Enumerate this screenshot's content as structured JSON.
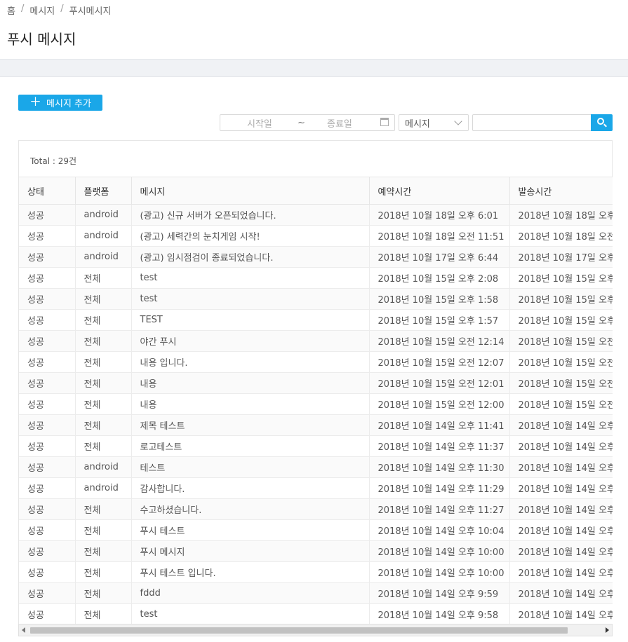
{
  "breadcrumb": {
    "home": "홈",
    "section": "메시지",
    "current": "푸시메시지",
    "separator": "/"
  },
  "page": {
    "title": "푸시 메시지"
  },
  "toolbar": {
    "add_label": "메시지 추가",
    "add_icon": "plus-icon",
    "date_start_placeholder": "시작일",
    "date_tilde": "~",
    "date_end_placeholder": "종료일",
    "select_value": "메시지",
    "search_value": "",
    "accent_color": "#1aa7e8"
  },
  "summary": {
    "total": "Total : 29건"
  },
  "table": {
    "columns": [
      "상태",
      "플랫폼",
      "메시지",
      "예약시간",
      "발송시간"
    ],
    "rows": [
      [
        "성공",
        "android",
        "(광고) 신규 서버가 오픈되었습니다.",
        "2018년 10월 18일 오후 6:01",
        "2018년 10월 18일 오후"
      ],
      [
        "성공",
        "android",
        "(광고) 세력간의 눈치게임 시작!",
        "2018년 10월 18일 오전 11:51",
        "2018년 10월 18일 오전"
      ],
      [
        "성공",
        "android",
        "(광고) 임시점검이 종료되었습니다.",
        "2018년 10월 17일 오후 6:44",
        "2018년 10월 17일 오후"
      ],
      [
        "성공",
        "전체",
        "test",
        "2018년 10월 15일 오후 2:08",
        "2018년 10월 15일 오후"
      ],
      [
        "성공",
        "전체",
        "test",
        "2018년 10월 15일 오후 1:58",
        "2018년 10월 15일 오후"
      ],
      [
        "성공",
        "전체",
        "TEST",
        "2018년 10월 15일 오후 1:57",
        "2018년 10월 15일 오후"
      ],
      [
        "성공",
        "전체",
        "야간 푸시",
        "2018년 10월 15일 오전 12:14",
        "2018년 10월 15일 오전"
      ],
      [
        "성공",
        "전체",
        "내용 입니다.",
        "2018년 10월 15일 오전 12:07",
        "2018년 10월 15일 오전"
      ],
      [
        "성공",
        "전체",
        "내용",
        "2018년 10월 15일 오전 12:01",
        "2018년 10월 15일 오전"
      ],
      [
        "성공",
        "전체",
        "내용",
        "2018년 10월 15일 오전 12:00",
        "2018년 10월 15일 오전"
      ],
      [
        "성공",
        "전체",
        "제목 테스트",
        "2018년 10월 14일 오후 11:41",
        "2018년 10월 14일 오후"
      ],
      [
        "성공",
        "전체",
        "로고테스트",
        "2018년 10월 14일 오후 11:37",
        "2018년 10월 14일 오후"
      ],
      [
        "성공",
        "android",
        "테스트",
        "2018년 10월 14일 오후 11:30",
        "2018년 10월 14일 오후"
      ],
      [
        "성공",
        "android",
        "감사합니다.",
        "2018년 10월 14일 오후 11:29",
        "2018년 10월 14일 오후"
      ],
      [
        "성공",
        "전체",
        "수고하셨습니다.",
        "2018년 10월 14일 오후 11:27",
        "2018년 10월 14일 오후"
      ],
      [
        "성공",
        "전체",
        "푸시 테스트",
        "2018년 10월 14일 오후 10:04",
        "2018년 10월 14일 오후"
      ],
      [
        "성공",
        "전체",
        "푸시 메시지",
        "2018년 10월 14일 오후 10:00",
        "2018년 10월 14일 오후"
      ],
      [
        "성공",
        "전체",
        "푸시 테스트 입니다.",
        "2018년 10월 14일 오후 10:00",
        "2018년 10월 14일 오후"
      ],
      [
        "성공",
        "전체",
        "fddd",
        "2018년 10월 14일 오후 9:59",
        "2018년 10월 14일 오후"
      ],
      [
        "성공",
        "전체",
        "test",
        "2018년 10월 14일 오후 9:58",
        "2018년 10월 14일 오후"
      ]
    ]
  }
}
